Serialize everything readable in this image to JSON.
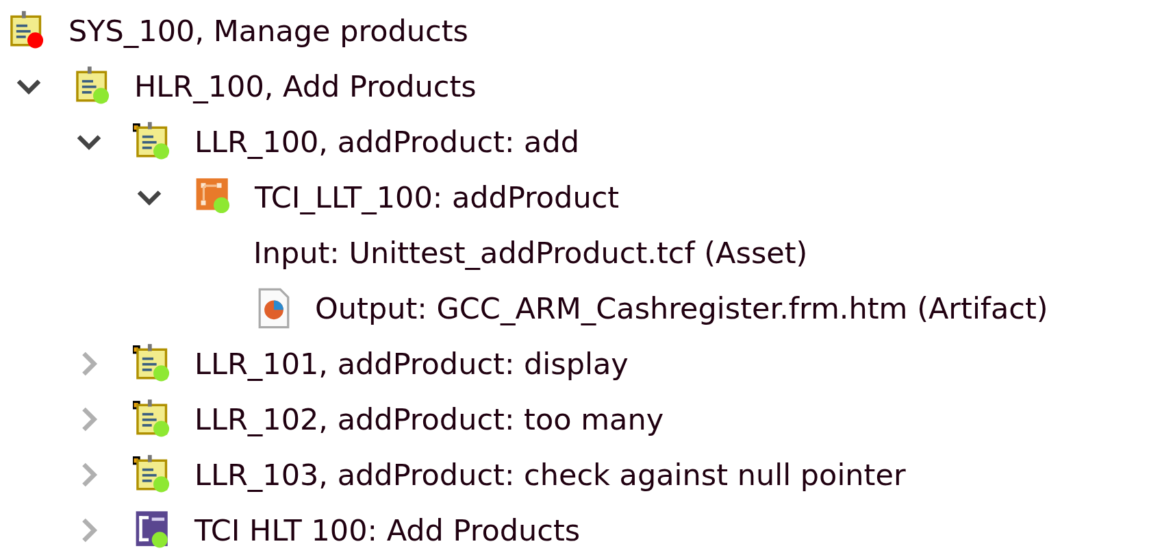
{
  "tree": [
    {
      "label": "SYS_100, Manage products",
      "kind": "requirement",
      "color": "#ff0000",
      "linked": false,
      "children": [
        {
          "label": "HLR_100, Add Products",
          "kind": "requirement",
          "color": "#8ee832",
          "linked": false,
          "expanded": true,
          "children": [
            {
              "label": "LLR_100, addProduct: add",
              "kind": "requirement",
              "color": "#8ee832",
              "linked": true,
              "expanded": true,
              "children": [
                {
                  "label": "TCI_LLT_100: addProduct",
                  "kind": "test_case",
                  "color": "#8ee832",
                  "linked": false,
                  "expanded": true,
                  "children": [
                    {
                      "label": "Input: Unittest_addProduct.tcf (Asset)",
                      "kind": "plain"
                    },
                    {
                      "label": "Output: GCC_ARM_Cashregister.frm.htm (Artifact)",
                      "kind": "file"
                    }
                  ]
                }
              ]
            },
            {
              "label": "LLR_101, addProduct: display",
              "kind": "requirement",
              "color": "#8ee832",
              "linked": true,
              "expanded": false
            },
            {
              "label": "LLR_102, addProduct: too many",
              "kind": "requirement",
              "color": "#8ee832",
              "linked": true,
              "expanded": false
            },
            {
              "label": "LLR_103, addProduct: check against null pointer",
              "kind": "requirement",
              "color": "#8ee832",
              "linked": true,
              "expanded": false
            },
            {
              "label": "TCI HLT 100: Add Products",
              "kind": "test_suite",
              "color": "#8ee832",
              "linked": false,
              "expanded": false
            }
          ]
        }
      ]
    }
  ]
}
